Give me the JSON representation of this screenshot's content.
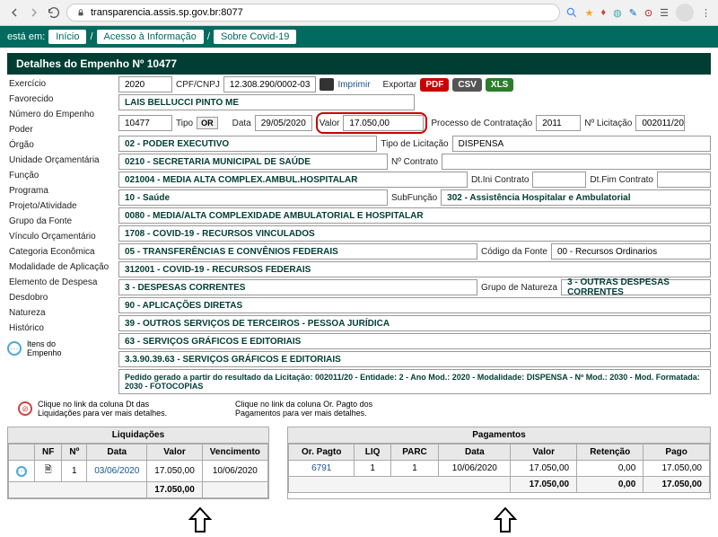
{
  "browser": {
    "url": "transparencia.assis.sp.gov.br:8077"
  },
  "breadcrumb": {
    "label": "está em:",
    "items": [
      "Início",
      "Acesso à Informação",
      "Sobre Covid-19"
    ]
  },
  "title": "Detalhes do Empenho Nº 10477",
  "sidebar": {
    "labels": [
      "Exercício",
      "Favorecido",
      "Número do Empenho",
      "Poder",
      "Órgão",
      "Unidade Orçamentária",
      "Função",
      "Programa",
      "Projeto/Atividade",
      "Grupo da Fonte",
      "Vínculo Orçamentário",
      "Categoria Econômica",
      "Modalidade de Aplicação",
      "Elemento de Despesa",
      "Desdobro",
      "Natureza",
      "Histórico"
    ],
    "itens": "Itens do\nEmpenho"
  },
  "fields": {
    "exercicio": "2020",
    "cpf_lbl": "CPF/CNPJ",
    "cpf": "12.308.290/0002-03",
    "imprimir": "Imprimir",
    "exportar": "Exportar",
    "pdf": "PDF",
    "csv": "CSV",
    "xls": "XLS",
    "favorecido": "LAIS BELLUCCI PINTO ME",
    "numero": "10477",
    "tipo_lbl": "Tipo",
    "tipo": "OR",
    "data_lbl": "Data",
    "data": "29/05/2020",
    "valor_lbl": "Valor",
    "valor": "17.050,00",
    "proc_lbl": "Processo de Contratação",
    "proc": "2011",
    "nlic_lbl": "Nº Licitação",
    "nlic": "002011/20",
    "poder": "02 - PODER EXECUTIVO",
    "tipo_lic_lbl": "Tipo de Licitação",
    "tipo_lic": "DISPENSA",
    "orgao": "0210 - SECRETARIA MUNICIPAL DE SAÚDE",
    "ncontrato_lbl": "Nº Contrato",
    "unidade": "021004 - MEDIA ALTA COMPLEX.AMBUL.HOSPITALAR",
    "dtini_lbl": "Dt.Ini Contrato",
    "dtfim_lbl": "Dt.Fim Contrato",
    "funcao": "10 - Saúde",
    "subf_lbl": "SubFunção",
    "subf": "302 - Assistência Hospitalar e Ambulatorial",
    "programa": "0080 - MEDIA/ALTA COMPLEXIDADE AMBULATORIAL E HOSPITALAR",
    "projeto": "1708 - COVID-19 - RECURSOS VINCULADOS",
    "grupo_fonte": "05 - TRANSFERÊNCIAS E CONVÊNIOS FEDERAIS",
    "cod_fonte_lbl": "Código da Fonte",
    "cod_fonte": "00 - Recursos Ordinarios",
    "vinculo": "312001 - COVID-19 - RECURSOS FEDERAIS",
    "categoria": "3 - DESPESAS CORRENTES",
    "gnat_lbl": "Grupo de Natureza",
    "gnat": "3 - OUTRAS DESPESAS CORRENTES",
    "modalidade": "90 - APLICAÇÕES DIRETAS",
    "elemento": "39 - OUTROS SERVIÇOS DE TERCEIROS - PESSOA JURÍDICA",
    "desdobro": "63 - SERVIÇOS GRÁFICOS E EDITORIAIS",
    "natureza": "3.3.90.39.63 - SERVIÇOS GRÁFICOS E EDITORIAIS",
    "historico": "Pedido gerado a partir do resultado da Licitação: 002011/20 - Entidade: 2 - Ano Mod.: 2020 - Modalidade: DISPENSA - Nº Mod.: 2030 - Mod. Formatada: 2030 - FOTOCOPIAS"
  },
  "hints": {
    "liq": "Clique no link da coluna Dt das Liquidações para ver mais detalhes.",
    "pag": "Clique no link da coluna Or. Pagto dos Pagamentos para ver mais detalhes."
  },
  "tables": {
    "liq": {
      "title": "Liquidações",
      "headers": [
        "",
        "NF",
        "Nº",
        "Data",
        "Valor",
        "Vencimento"
      ],
      "row": {
        "nf": "📄",
        "n": "1",
        "data": "03/06/2020",
        "valor": "17.050,00",
        "venc": "10/06/2020"
      },
      "total": "17.050,00"
    },
    "pag": {
      "title": "Pagamentos",
      "headers": [
        "Or. Pagto",
        "LIQ",
        "PARC",
        "Data",
        "Valor",
        "Retenção",
        "Pago"
      ],
      "row": {
        "or": "6791",
        "liq": "1",
        "parc": "1",
        "data": "10/06/2020",
        "valor": "17.050,00",
        "ret": "0,00",
        "pago": "17.050,00"
      },
      "total": {
        "valor": "17.050,00",
        "ret": "0,00",
        "pago": "17.050,00"
      }
    }
  }
}
